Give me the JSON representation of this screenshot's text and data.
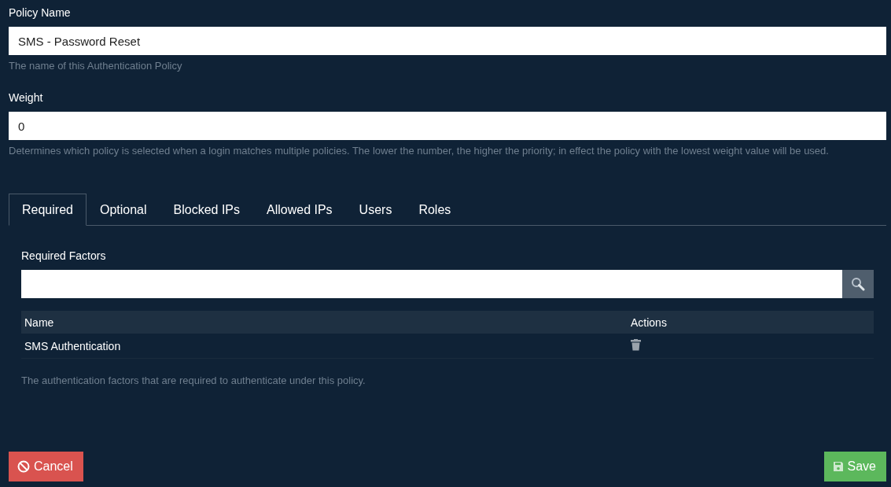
{
  "fields": [
    {
      "label": "Policy Name",
      "value": "SMS - Password Reset",
      "hint": "The name of this Authentication Policy"
    },
    {
      "label": "Weight",
      "value": "0",
      "hint": "Determines which policy is selected when a login matches multiple policies. The lower the number, the higher the priority; in effect the policy with the lowest weight value will be used."
    }
  ],
  "tabs": [
    {
      "label": "Required",
      "selected": true
    },
    {
      "label": "Optional",
      "selected": false
    },
    {
      "label": "Blocked IPs",
      "selected": false
    },
    {
      "label": "Allowed IPs",
      "selected": false
    },
    {
      "label": "Users",
      "selected": false
    },
    {
      "label": "Roles",
      "selected": false
    }
  ],
  "panel": {
    "label": "Required Factors",
    "table": {
      "columns": [
        "Name",
        "Actions"
      ],
      "rows": [
        {
          "name": "SMS Authentication"
        }
      ]
    },
    "hint": "The authentication factors that are required to authenticate under this policy."
  },
  "buttons": [
    {
      "kind": "cancel",
      "label": "Cancel"
    },
    {
      "kind": "save",
      "label": "Save"
    }
  ]
}
